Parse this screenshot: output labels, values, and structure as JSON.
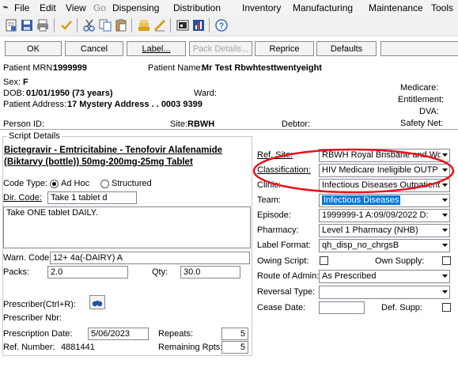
{
  "menu": {
    "system_glyph": "⌁",
    "items": [
      "File",
      "Edit",
      "View",
      "Go",
      "Dispensing",
      "Distribution",
      "Inventory",
      "Manufacturing",
      "Maintenance",
      "Tools"
    ]
  },
  "toolbar": {
    "icons": [
      "report-icon",
      "save-icon",
      "print-icon",
      "tick-icon",
      "scissors-icon",
      "copy-icon",
      "paste-icon",
      "stack-icon",
      "edit-icon",
      "image-icon",
      "chart-icon",
      "help-icon"
    ]
  },
  "buttons": {
    "ok": "OK",
    "cancel": "Cancel",
    "label": "Label...",
    "pack_details": "Pack Details...",
    "reprice": "Reprice",
    "defaults": "Defaults"
  },
  "patient": {
    "mrn_label": "Patient MRN:",
    "mrn": "1999999",
    "name_label": "Patient Name:",
    "name": "Mr Test Rbwhtesttwentyeight",
    "sex_label": "Sex:",
    "sex": "F",
    "dob_label": "DOB:",
    "dob": "01/01/1950 (73 years)",
    "ward_label": "Ward:",
    "address_label": "Patient Address:",
    "address": "17 Mystery Address . . 0003 9399",
    "medicare_label": "Medicare:",
    "entitlement_label": "Entitlement:",
    "dva_label": "DVA:",
    "safety_net_label": "Safety Net:",
    "person_id_label": "Person ID:",
    "site_label": "Site:",
    "site": "RBWH",
    "debtor_label": "Debtor:"
  },
  "script": {
    "group_title": "Script Details",
    "drug_line1": "Bictegravir - Emtricitabine - Tenofovir Alafenamide",
    "drug_line2": "(Biktarvy (bottle)) 50mg-200mg-25mg Tablet",
    "code_type_label": "Code Type:",
    "code_type_adhoc": "Ad Hoc",
    "code_type_structured": "Structured",
    "dir_code_label": "Dir. Code:",
    "dir_code": "Take 1 tablet d",
    "directions": "Take ONE tablet DAILY.",
    "warn_code_label": "Warn. Code:",
    "warn_code": "12+ 4a(-DAIRY) A",
    "packs_label": "Packs:",
    "packs": "2.0",
    "qty_label": "Qty:",
    "qty": "30.0",
    "prescriber_label": "Prescriber(Ctrl+R):",
    "prescriber_nbr_label": "Prescriber Nbr:",
    "prescriber_nbr": "",
    "prescription_date_label": "Prescription Date:",
    "prescription_date": "5/06/2023",
    "repeats_label": "Repeats:",
    "repeats": "5",
    "ref_number_label": "Ref. Number:",
    "ref_number": "4881441",
    "remaining_label": "Remaining Rpts:",
    "remaining": "5"
  },
  "right_panel": {
    "ref_site_label": "Ref. Site:",
    "ref_site": "RBWH  Royal Brisbane and Wo",
    "classification_label": "Classification:",
    "classification": "HIV Medicare Ineligible OUTP",
    "clinic_label": "Clinic:",
    "clinic": "Infectious Diseases Outpatients",
    "team_label": "Team:",
    "team": "Infectious Diseases",
    "episode_label": "Episode:",
    "episode": "1999999-1  A:09/09/2022  D:",
    "pharmacy_label": "Pharmacy:",
    "pharmacy": "Level 1 Pharmacy (NHB)",
    "label_format_label": "Label Format:",
    "label_format": "qh_disp_no_chrgsB",
    "owing_script_label": "Owing Script:",
    "own_supply_label": "Own Supply:",
    "route_label": "Route of Admin:",
    "route": "As Prescribed",
    "reversal_type_label": "Reversal Type:",
    "reversal_type": "",
    "cease_date_label": "Cease Date:",
    "cease_date": "",
    "def_supp_label": "Def. Supp:"
  },
  "colors": {
    "highlight_ellipse": "#e8131b",
    "selection": "#0078d7",
    "menubar": "#f3f3f3"
  }
}
